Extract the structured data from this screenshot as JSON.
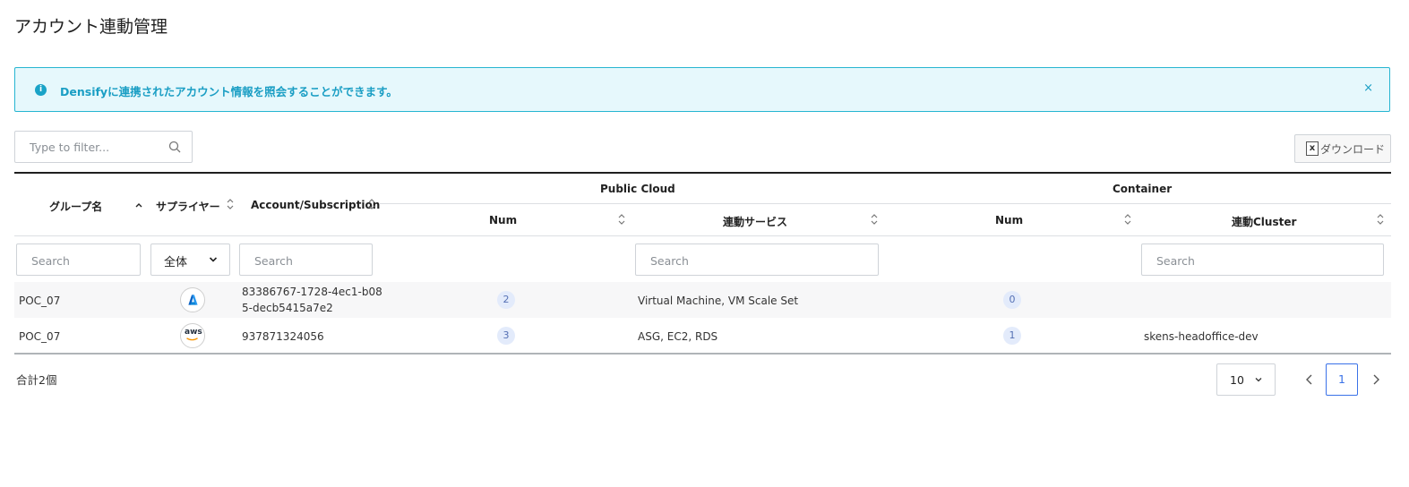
{
  "page": {
    "title": "アカウント連動管理"
  },
  "banner": {
    "icon": "info-icon",
    "text": "Densifyに連携されたアカウント情報を照会することができます。",
    "close_label": "×"
  },
  "filter": {
    "placeholder": "Type to filter..."
  },
  "download": {
    "label": "ダウンロード",
    "icon": "excel-icon",
    "icon_text": "x"
  },
  "table": {
    "group_headers": {
      "public_cloud": "Public Cloud",
      "container": "Container"
    },
    "columns": {
      "group": "グループ名",
      "supplier": "サプライヤー",
      "account": "Account/Subscription",
      "pc_num": "Num",
      "pc_services": "連動サービス",
      "ct_num": "Num",
      "ct_cluster": "連動Cluster"
    },
    "filters": {
      "group_placeholder": "Search",
      "supplier_selected": "全体",
      "account_placeholder": "Search",
      "services_placeholder": "Search",
      "cluster_placeholder": "Search"
    },
    "rows": [
      {
        "group": "POC_07",
        "supplier": "azure",
        "account_line1": "83386767-1728-4ec1-b08",
        "account_line2": "5-decb5415a7e2",
        "pc_num": "2",
        "pc_services": "Virtual Machine, VM Scale Set",
        "ct_num": "0",
        "ct_cluster": ""
      },
      {
        "group": "POC_07",
        "supplier": "aws",
        "supplier_text": "aws",
        "account_line1": "937871324056",
        "account_line2": "",
        "pc_num": "3",
        "pc_services": "ASG, EC2, RDS",
        "ct_num": "1",
        "ct_cluster": "skens-headoffice-dev"
      }
    ]
  },
  "footer": {
    "total": "合計2個",
    "page_size": "10",
    "current_page": "1"
  },
  "colors": {
    "accent": "#3a72e8",
    "banner_border": "#26b5d1",
    "banner_text": "#1a9ec4"
  }
}
